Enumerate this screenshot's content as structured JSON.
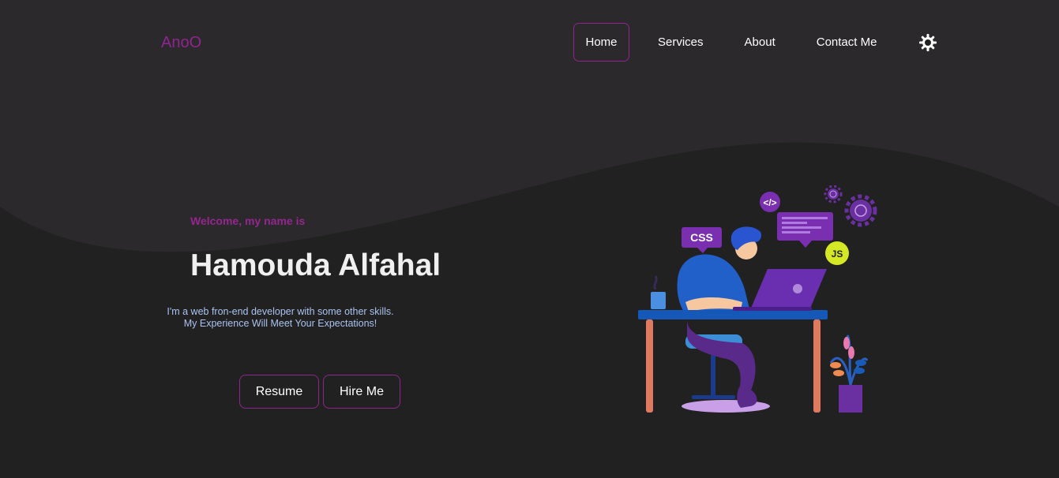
{
  "nav": {
    "logo": "AnoO",
    "links": [
      {
        "label": "Home",
        "active": true
      },
      {
        "label": "Services",
        "active": false
      },
      {
        "label": "About",
        "active": false
      },
      {
        "label": "Contact Me",
        "active": false
      }
    ],
    "theme_icon": "sun-icon"
  },
  "hero": {
    "greeting": "Welcome, my name is",
    "name": "Hamouda Alfahal",
    "description_line1": "I'm a web fron-end developer with some other skills.",
    "description_line2": "My Experience Will Meet Your Expectations!",
    "buttons": {
      "resume": "Resume",
      "hire": "Hire Me"
    }
  },
  "illustration": {
    "css_badge": "CSS",
    "js_badge": "JS",
    "code_icon": "</>"
  },
  "colors": {
    "background": "#222122",
    "wave": "#2b292b",
    "accent": "#8f2590",
    "description": "#a8c3f0"
  }
}
